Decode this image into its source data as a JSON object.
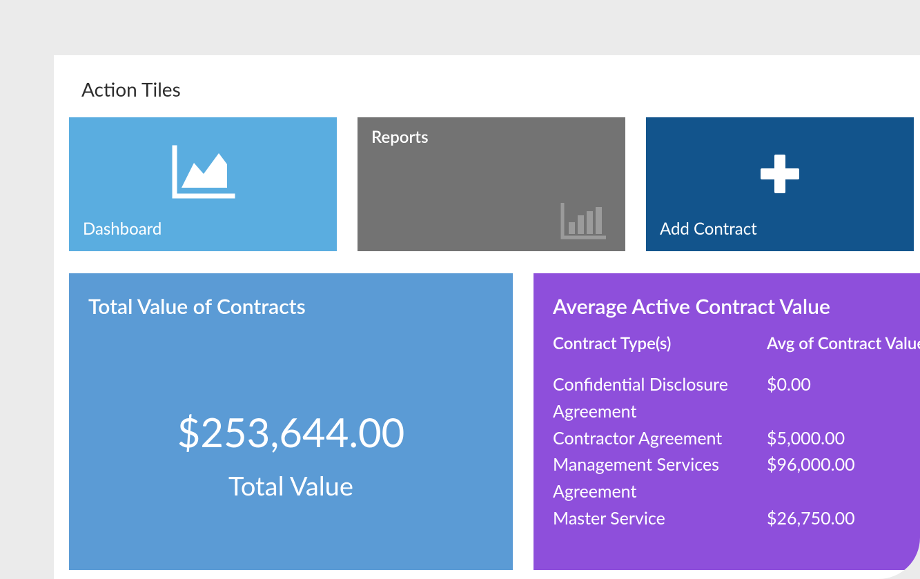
{
  "section_title": "Action Tiles",
  "tiles": {
    "dashboard": {
      "label": "Dashboard"
    },
    "reports": {
      "label": "Reports"
    },
    "add_contract": {
      "label": "Add Contract"
    }
  },
  "total_card": {
    "title": "Total Value of Contracts",
    "value": "$253,644.00",
    "label": "Total Value"
  },
  "avg_card": {
    "title": "Average Active Contract Value",
    "columns": {
      "type": "Contract Type(s)",
      "value": "Avg of Contract Value"
    },
    "rows": [
      {
        "type": "Confidential Disclosure Agreement",
        "value": "$0.00"
      },
      {
        "type": "Contractor Agreement",
        "value": "$5,000.00"
      },
      {
        "type": "Management Services Agreement",
        "value": "$96,000.00"
      },
      {
        "type": "Master Service",
        "value": "$26,750.00"
      }
    ]
  },
  "chart_data": {
    "type": "table",
    "title": "Average Active Contract Value",
    "columns": [
      "Contract Type(s)",
      "Avg of Contract Value"
    ],
    "rows": [
      [
        "Confidential Disclosure Agreement",
        0.0
      ],
      [
        "Contractor Agreement",
        5000.0
      ],
      [
        "Management Services Agreement",
        96000.0
      ],
      [
        "Master Service",
        26750.0
      ]
    ]
  }
}
